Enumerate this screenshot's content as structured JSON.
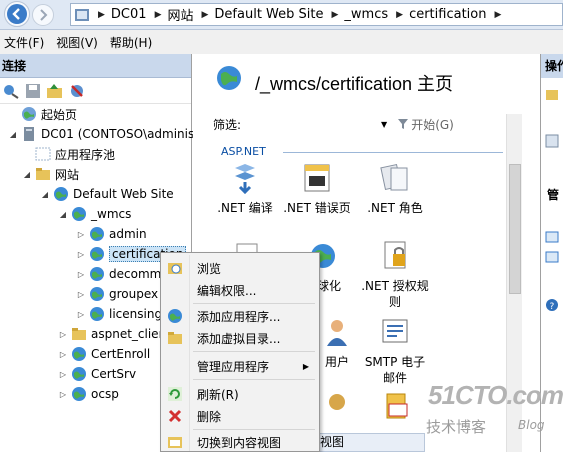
{
  "breadcrumb": {
    "items": [
      "DC01",
      "网站",
      "Default Web Site",
      "_wmcs",
      "certification"
    ]
  },
  "menubar": {
    "items": [
      "文件(F)",
      "视图(V)",
      "帮助(H)"
    ]
  },
  "left_pane": {
    "title": "连接",
    "tree": [
      {
        "label": "起始页",
        "icon": "start-page-icon",
        "twisty": ""
      },
      {
        "label": "DC01 (CONTOSO\\administ",
        "icon": "server-icon",
        "twisty": "◢"
      },
      {
        "label": "应用程序池",
        "icon": "app-pool-icon",
        "twisty": ""
      },
      {
        "label": "网站",
        "icon": "sites-folder-icon",
        "twisty": "◢"
      },
      {
        "label": "Default Web Site",
        "icon": "globe-icon",
        "twisty": "◢"
      },
      {
        "label": "_wmcs",
        "icon": "web-app-icon",
        "twisty": "◢"
      },
      {
        "label": "admin",
        "icon": "web-app-icon",
        "twisty": "▷"
      },
      {
        "label": "certification",
        "icon": "web-app-icon",
        "twisty": "▷"
      },
      {
        "label": "decomm",
        "icon": "web-app-icon",
        "twisty": "▷"
      },
      {
        "label": "groupex",
        "icon": "web-app-icon",
        "twisty": "▷"
      },
      {
        "label": "licensing",
        "icon": "web-app-icon",
        "twisty": "▷"
      },
      {
        "label": "aspnet_clien",
        "icon": "folder-icon",
        "twisty": "▷"
      },
      {
        "label": "CertEnroll",
        "icon": "web-app-icon",
        "twisty": "▷"
      },
      {
        "label": "CertSrv",
        "icon": "web-app-icon",
        "twisty": "▷"
      },
      {
        "label": "ocsp",
        "icon": "web-app-icon",
        "twisty": "▷"
      }
    ]
  },
  "center": {
    "title": "/_wmcs/certification 主页",
    "filter_label": "筛选:",
    "go_label": "开始(G)",
    "section": "ASP.NET",
    "features": [
      {
        "label": ".NET 编译",
        "icon": "net-compile-icon"
      },
      {
        "label": ".NET 错误页",
        "icon": "net-error-page-icon"
      },
      {
        "label": ".NET 角色",
        "icon": "net-roles-icon"
      },
      {
        "label": "全球化",
        "icon": "net-globalization-icon"
      },
      {
        "label": ".NET 授权规则",
        "icon": "net-authorization-icon"
      },
      {
        "label": "用户",
        "icon": "net-users-icon"
      },
      {
        "label": "SMTP 电子邮件",
        "icon": "smtp-email-icon"
      }
    ],
    "bottom_tab": "视图"
  },
  "right_pane": {
    "title": "操作",
    "head": "管"
  },
  "context_menu": {
    "items": [
      {
        "label": "浏览",
        "icon": "browse-icon"
      },
      {
        "label": "编辑权限...",
        "icon": ""
      },
      {
        "label": "添加应用程序...",
        "icon": "add-app-icon"
      },
      {
        "label": "添加虚拟目录...",
        "icon": "add-vdir-icon"
      },
      {
        "label": "管理应用程序",
        "icon": ""
      },
      {
        "label": "刷新(R)",
        "icon": "refresh-icon"
      },
      {
        "label": "删除",
        "icon": "delete-icon"
      },
      {
        "label": "切换到内容视图",
        "icon": "content-view-icon"
      }
    ]
  },
  "watermark": {
    "main": "51CTO.com",
    "sub": "技术博客",
    "blog": "Blog"
  }
}
